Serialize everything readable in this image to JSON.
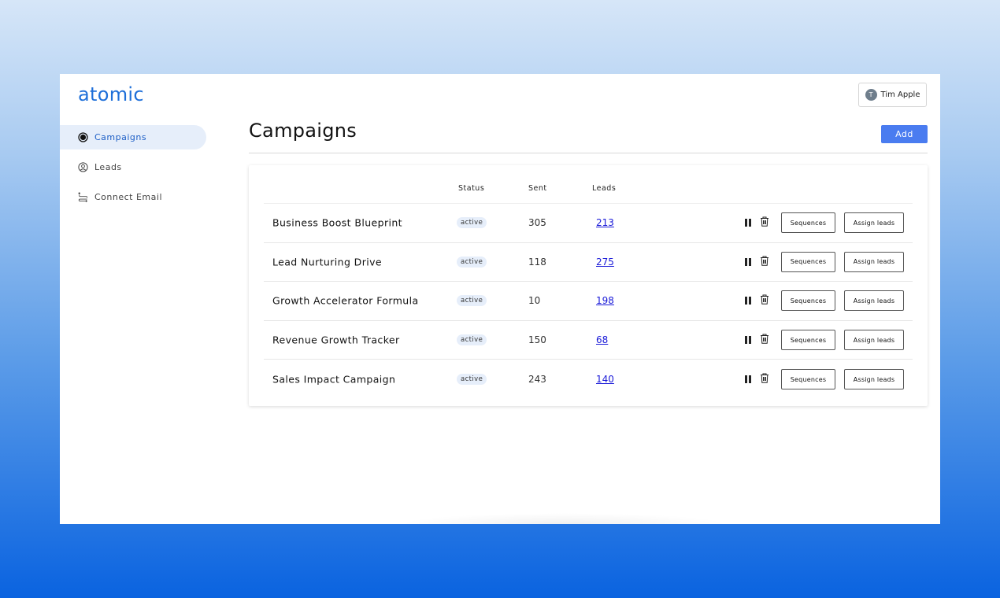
{
  "app": {
    "logo": "atomic"
  },
  "user": {
    "name": "Tim Apple",
    "initial": "T"
  },
  "sidebar": {
    "items": [
      {
        "label": "Campaigns",
        "icon": "radio-filled-icon",
        "active": true
      },
      {
        "label": "Leads",
        "icon": "user-circle-icon",
        "active": false
      },
      {
        "label": "Connect Email",
        "icon": "connect-arrows-icon",
        "active": false
      }
    ]
  },
  "main": {
    "title": "Campaigns",
    "add_label": "Add",
    "table": {
      "headers": {
        "status": "Status",
        "sent": "Sent",
        "leads": "Leads"
      },
      "rows": [
        {
          "name": "Business Boost Blueprint",
          "status": "active",
          "sent": "305",
          "leads": "213",
          "sequences_label": "Sequences",
          "assign_label": "Assign leads"
        },
        {
          "name": "Lead Nurturing Drive",
          "status": "active",
          "sent": "118",
          "leads": "275",
          "sequences_label": "Sequences",
          "assign_label": "Assign leads"
        },
        {
          "name": "Growth Accelerator Formula",
          "status": "active",
          "sent": "10",
          "leads": "198",
          "sequences_label": "Sequences",
          "assign_label": "Assign leads"
        },
        {
          "name": "Revenue Growth Tracker",
          "status": "active",
          "sent": "150",
          "leads": "68",
          "sequences_label": "Sequences",
          "assign_label": "Assign leads"
        },
        {
          "name": "Sales Impact Campaign",
          "status": "active",
          "sent": "243",
          "leads": "140",
          "sequences_label": "Sequences",
          "assign_label": "Assign leads"
        }
      ]
    }
  },
  "colors": {
    "brand": "#1e6fd9",
    "accent": "#4a7cf0",
    "link": "#1a1ad8",
    "active_nav_bg": "#e6eefa"
  }
}
